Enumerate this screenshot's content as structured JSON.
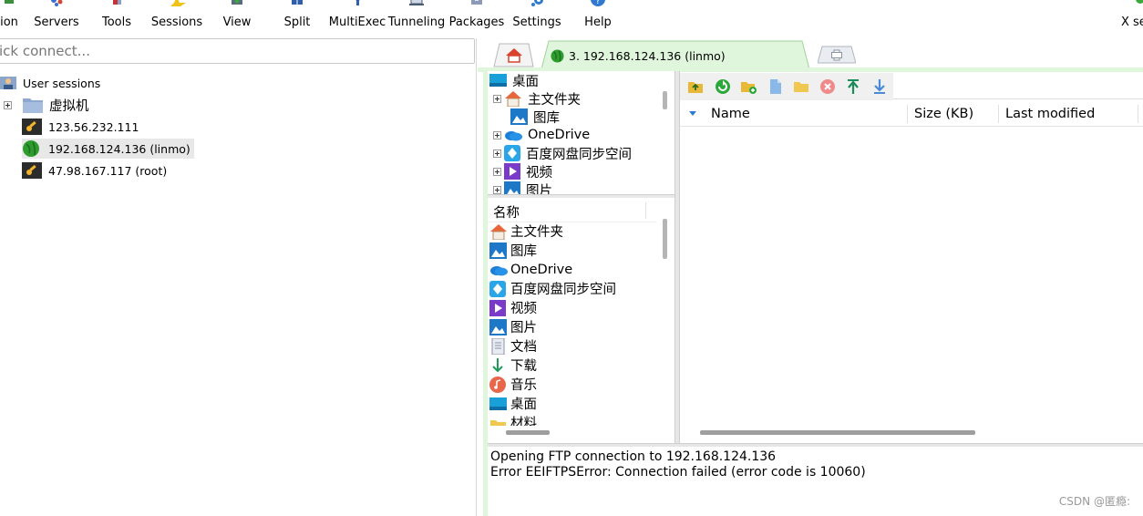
{
  "toolbar": {
    "items": [
      {
        "label": "ion",
        "icon": "session-icon"
      },
      {
        "label": "Servers",
        "icon": "servers-icon"
      },
      {
        "label": "Tools",
        "icon": "tools-icon"
      },
      {
        "label": "Sessions",
        "icon": "sessions-star-icon"
      },
      {
        "label": "View",
        "icon": "view-icon"
      },
      {
        "label": "Split",
        "icon": "split-icon"
      },
      {
        "label": "MultiExec",
        "icon": "multiexec-icon"
      },
      {
        "label": "Tunneling",
        "icon": "tunneling-icon"
      },
      {
        "label": "Packages",
        "icon": "packages-icon"
      },
      {
        "label": "Settings",
        "icon": "settings-gear-icon"
      },
      {
        "label": "Help",
        "icon": "help-icon"
      }
    ],
    "xserver_label": "X se"
  },
  "quick_connect": {
    "placeholder": "ick connect..."
  },
  "sessions": {
    "root_label": "User sessions",
    "folder_label": "虚拟机",
    "items": [
      {
        "label": "123.56.232.111",
        "icon": "ssh-key-icon"
      },
      {
        "label": "192.168.124.136 (linmo)",
        "icon": "globe-icon"
      },
      {
        "label": "47.98.167.117 (root)",
        "icon": "ssh-key-icon"
      }
    ]
  },
  "tabs": {
    "home_icon": "home-icon",
    "active_label": "3. 192.168.124.136 (linmo)",
    "add_icon": "plus-icon"
  },
  "local_tree": {
    "items": [
      {
        "label": "桌面",
        "icon": "desktop-icon"
      },
      {
        "label": "主文件夹",
        "icon": "home-folder-icon"
      },
      {
        "label": "图库",
        "icon": "gallery-icon"
      },
      {
        "label": "OneDrive",
        "icon": "onedrive-icon"
      },
      {
        "label": "百度网盘同步空间",
        "icon": "baidu-netdisk-icon"
      },
      {
        "label": "视频",
        "icon": "video-icon"
      },
      {
        "label": "图片",
        "icon": "pictures-icon"
      }
    ]
  },
  "local_list": {
    "header": "名称",
    "items": [
      {
        "label": "主文件夹",
        "icon": "home-folder-icon"
      },
      {
        "label": "图库",
        "icon": "gallery-icon"
      },
      {
        "label": "OneDrive",
        "icon": "onedrive-icon"
      },
      {
        "label": "百度网盘同步空间",
        "icon": "baidu-netdisk-icon"
      },
      {
        "label": "视频",
        "icon": "video-icon"
      },
      {
        "label": "图片",
        "icon": "pictures-icon"
      },
      {
        "label": "文档",
        "icon": "documents-icon"
      },
      {
        "label": "下载",
        "icon": "download-arrow-icon"
      },
      {
        "label": "音乐",
        "icon": "music-icon"
      },
      {
        "label": "桌面",
        "icon": "desktop-icon"
      },
      {
        "label": "材料",
        "icon": "folder-icon"
      }
    ]
  },
  "remote": {
    "toolbar_icons": [
      "parent-folder-icon",
      "refresh-icon",
      "new-folder-icon",
      "new-file-icon",
      "open-folder-icon",
      "delete-icon",
      "upload-icon",
      "download-icon"
    ],
    "columns": {
      "name": "Name",
      "size": "Size (KB)",
      "modified": "Last modified"
    }
  },
  "log": {
    "lines": [
      "Opening FTP connection to 192.168.124.136",
      "Error EEIFTPSError: Connection failed (error code is 10060)"
    ]
  },
  "watermark": "CSDN @匿瘾:",
  "colors": {
    "tab_green": "#dff6dc",
    "active_globe": "#2e9b2e",
    "accent_blue": "#1a73c9"
  }
}
